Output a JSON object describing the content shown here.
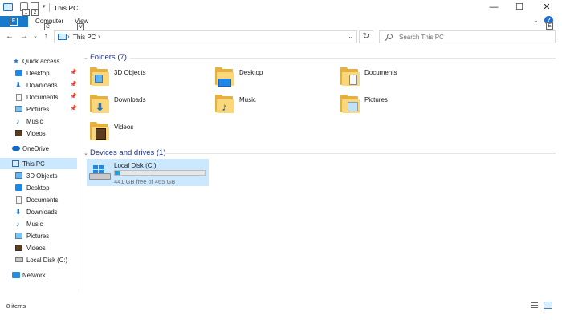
{
  "window": {
    "title": "This PC",
    "quick_access_keys": [
      "1",
      "2"
    ],
    "controls": {
      "minimize": "—",
      "maximize": "☐",
      "close": "✕"
    }
  },
  "ribbon": {
    "file_key": "F",
    "tabs": [
      {
        "label": "Computer",
        "key": "C"
      },
      {
        "label": "View",
        "key": "V"
      }
    ],
    "help_key": "E"
  },
  "address_bar": {
    "path": "This PC",
    "separator": "›",
    "back": "←",
    "forward": "→",
    "dropdown": "⌄",
    "up": "↑",
    "refresh": "↻",
    "search_placeholder": "Search This PC"
  },
  "nav_pane": {
    "quick_access": {
      "label": "Quick access",
      "items": [
        {
          "label": "Desktop",
          "icon": "desktop-icon",
          "pinned": true
        },
        {
          "label": "Downloads",
          "icon": "downloads-icon",
          "pinned": true
        },
        {
          "label": "Documents",
          "icon": "documents-icon",
          "pinned": true
        },
        {
          "label": "Pictures",
          "icon": "pictures-icon",
          "pinned": true
        },
        {
          "label": "Music",
          "icon": "music-icon",
          "pinned": false
        },
        {
          "label": "Videos",
          "icon": "videos-icon",
          "pinned": false
        }
      ]
    },
    "onedrive": "OneDrive",
    "this_pc": {
      "label": "This PC",
      "items": [
        {
          "label": "3D Objects",
          "icon": "3d-objects-icon"
        },
        {
          "label": "Desktop",
          "icon": "desktop-icon"
        },
        {
          "label": "Documents",
          "icon": "documents-icon"
        },
        {
          "label": "Downloads",
          "icon": "downloads-icon"
        },
        {
          "label": "Music",
          "icon": "music-icon"
        },
        {
          "label": "Pictures",
          "icon": "pictures-icon"
        },
        {
          "label": "Videos",
          "icon": "videos-icon"
        },
        {
          "label": "Local Disk (C:)",
          "icon": "drive-icon"
        }
      ]
    },
    "network": "Network"
  },
  "content": {
    "folders_header": "Folders (7)",
    "folders": [
      {
        "label": "3D Objects",
        "icon": "3d-objects-folder-icon"
      },
      {
        "label": "Desktop",
        "icon": "desktop-folder-icon"
      },
      {
        "label": "Documents",
        "icon": "documents-folder-icon"
      },
      {
        "label": "Downloads",
        "icon": "downloads-folder-icon"
      },
      {
        "label": "Music",
        "icon": "music-folder-icon"
      },
      {
        "label": "Pictures",
        "icon": "pictures-folder-icon"
      },
      {
        "label": "Videos",
        "icon": "videos-folder-icon"
      }
    ],
    "devices_header": "Devices and drives (1)",
    "drive": {
      "name": "Local Disk (C:)",
      "free_text": "441 GB free of 465 GB",
      "used_fraction": 0.052
    }
  },
  "status_bar": {
    "item_count": "8 items"
  },
  "colors": {
    "accent": "#1979ca",
    "selection": "#cce8ff",
    "folder": "#f9d77a",
    "group_header": "#1e3287",
    "drive_fill": "#26a0da"
  }
}
